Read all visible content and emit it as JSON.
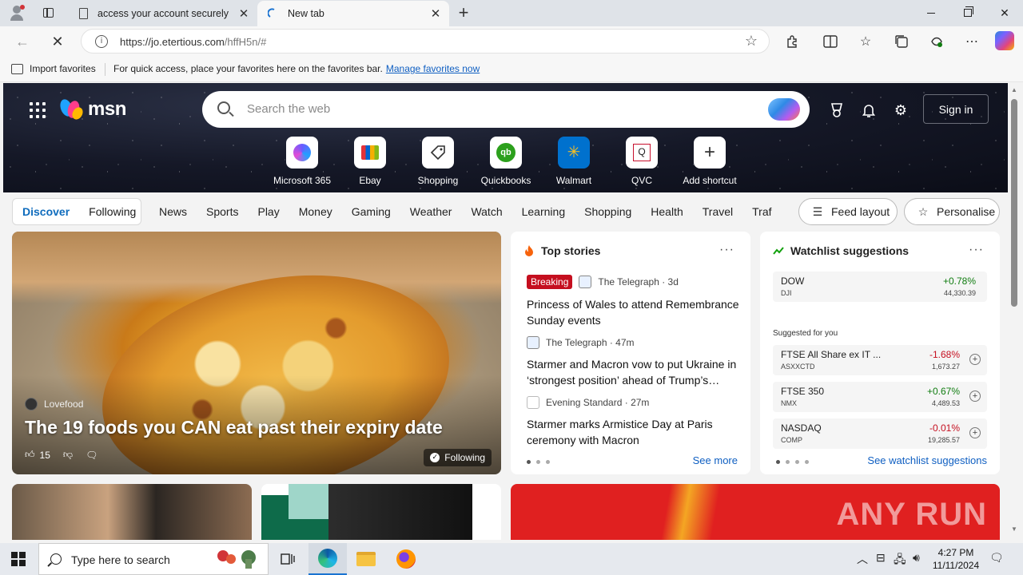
{
  "browser": {
    "tabs": [
      {
        "label": "access your account securely"
      },
      {
        "label": "New tab"
      }
    ],
    "url_host": "https://jo.etertious.com",
    "url_path": "/hffH5n/#",
    "favorites_bar": {
      "import_label": "Import favorites",
      "message": "For quick access, place your favorites here on the favorites bar.",
      "manage_link": "Manage favorites now"
    }
  },
  "msn": {
    "logo_text": "msn",
    "search_placeholder": "Search the web",
    "sign_in": "Sign in",
    "shortcuts": [
      {
        "label": "Microsoft 365"
      },
      {
        "label": "Ebay"
      },
      {
        "label": "Shopping"
      },
      {
        "label": "Quickbooks"
      },
      {
        "label": "Walmart"
      },
      {
        "label": "QVC"
      },
      {
        "label": "Add shortcut"
      }
    ],
    "segments": [
      "Discover",
      "Following"
    ],
    "nav_links": [
      "News",
      "Sports",
      "Play",
      "Money",
      "Gaming",
      "Weather",
      "Watch",
      "Learning",
      "Shopping",
      "Health",
      "Travel",
      "Traf"
    ],
    "feed_layout": "Feed layout",
    "personalise": "Personalise",
    "hero_story": {
      "source": "Lovefood",
      "headline": "The 19 foods you CAN eat past their expiry date",
      "likes": "15",
      "following": "Following"
    },
    "top_stories": {
      "heading": "Top stories",
      "items": [
        {
          "badge": "Breaking",
          "publisher": "The Telegraph · 3d",
          "title": "Princess of Wales to attend Remembrance Sunday events"
        },
        {
          "publisher": "The Telegraph · 47m",
          "title": "Starmer and Macron vow to put Ukraine in ‘strongest position’ ahead of Trump’s…"
        },
        {
          "publisher": "Evening Standard · 27m",
          "title": "Starmer marks Armistice Day at Paris ceremony with Macron"
        }
      ],
      "see_more": "See more"
    },
    "watchlist": {
      "heading": "Watchlist suggestions",
      "featured": {
        "symbol": "DOW",
        "sub": "DJI",
        "change": "+0.78%",
        "value": "44,330.39",
        "trend": "up"
      },
      "suggested_label": "Suggested for you",
      "items": [
        {
          "symbol": "FTSE All Share ex IT ...",
          "sub": "ASXXCTD",
          "change": "-1.68%",
          "value": "1,673.27",
          "trend": "down"
        },
        {
          "symbol": "FTSE 350",
          "sub": "NMX",
          "change": "+0.67%",
          "value": "4,489.53",
          "trend": "up"
        },
        {
          "symbol": "NASDAQ",
          "sub": "COMP",
          "change": "-0.01%",
          "value": "19,285.57",
          "trend": "down"
        }
      ],
      "see_all": "See watchlist suggestions"
    },
    "watermark": "ANY RUN"
  },
  "taskbar": {
    "search_placeholder": "Type here to search",
    "time": "4:27 PM",
    "date": "11/11/2024"
  }
}
